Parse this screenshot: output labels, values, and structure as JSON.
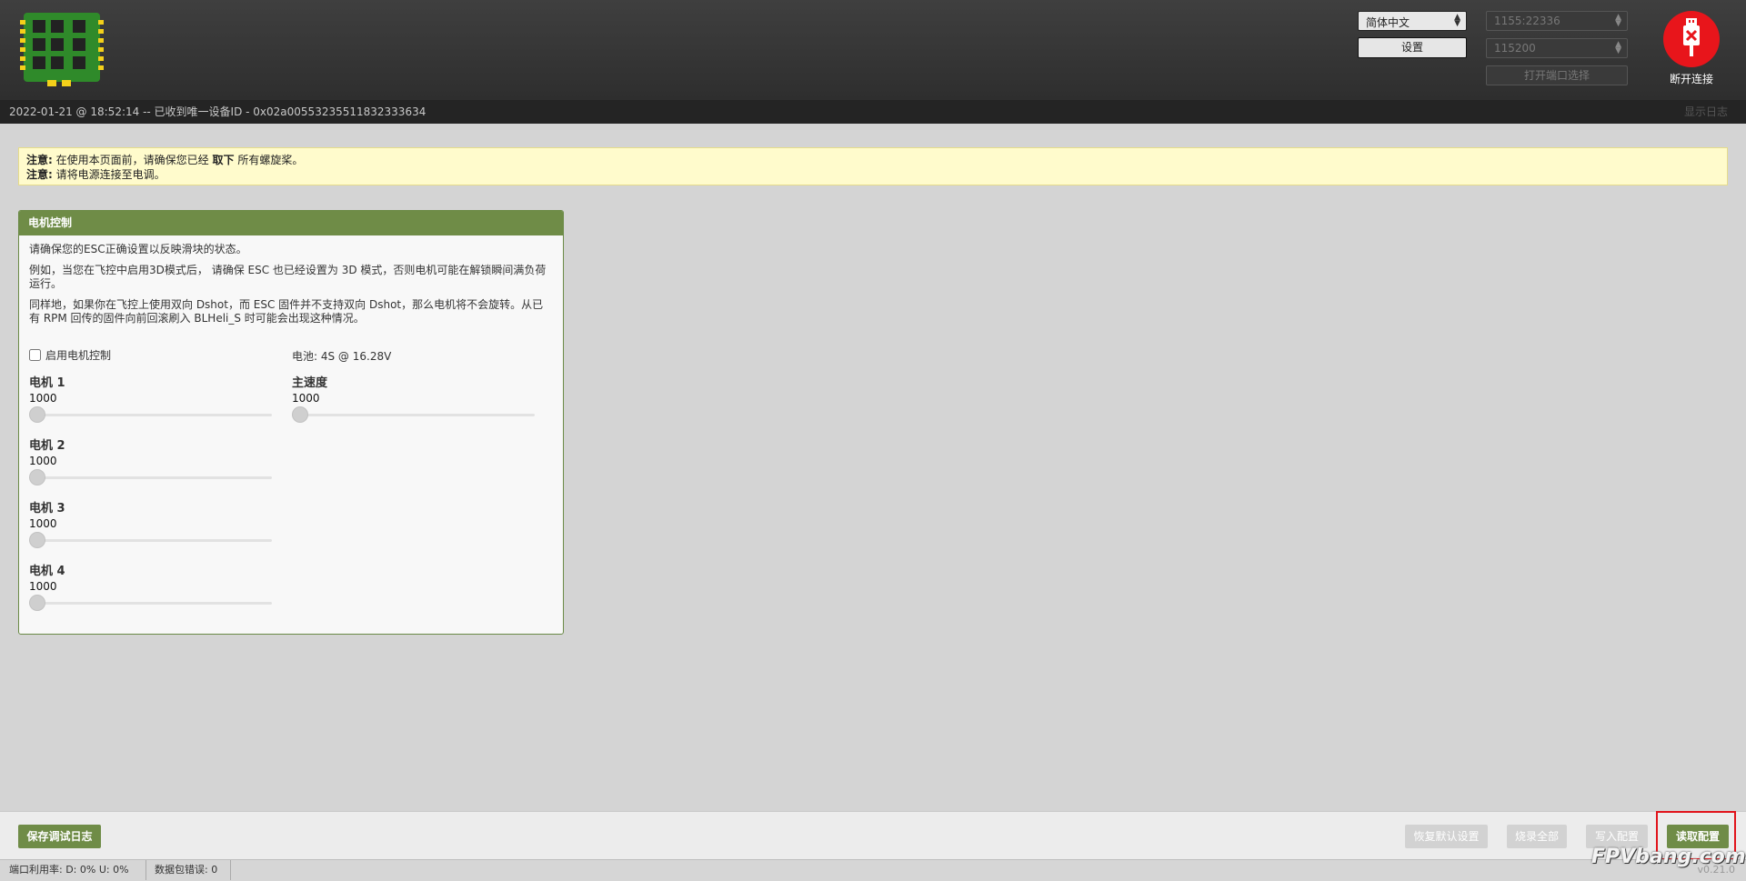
{
  "header": {
    "language": "简体中文",
    "settings_label": "设置",
    "port": "1155:22336",
    "baud": "115200",
    "open_port_label": "打开端口选择",
    "disconnect_label": "断开连接"
  },
  "statusbar": {
    "message": "2022-01-21 @ 18:52:14 -- 已收到唯一设备ID - 0x02a00553235511832333634",
    "show_log": "显示日志"
  },
  "notes": [
    {
      "label": "注意:",
      "text_before": "在使用本页面前，请确保您已经",
      "bold": "取下",
      "text_after": "所有螺旋桨。"
    },
    {
      "label": "注意:",
      "text_before": "请将电源连接至电调。",
      "bold": "",
      "text_after": ""
    }
  ],
  "motor_panel": {
    "title": "电机控制",
    "p1": "请确保您的ESC正确设置以反映滑块的状态。",
    "p2": "例如，当您在飞控中启用3D模式后， 请确保 ESC 也已经设置为 3D 模式，否则电机可能在解锁瞬间满负荷运行。",
    "p3": "同样地，如果你在飞控上使用双向 Dshot，而 ESC 固件并不支持双向 Dshot，那么电机将不会旋转。从已有 RPM 回传的固件向前回滚刷入 BLHeli_S 时可能会出现这种情况。",
    "enable_label": "启用电机控制",
    "battery": "电池: 4S @ 16.28V",
    "master": {
      "name": "主速度",
      "value": "1000",
      "fraction": 0
    },
    "motors": [
      {
        "name": "电机 1",
        "value": "1000",
        "fraction": 0
      },
      {
        "name": "电机 2",
        "value": "1000",
        "fraction": 0
      },
      {
        "name": "电机 3",
        "value": "1000",
        "fraction": 0
      },
      {
        "name": "电机 4",
        "value": "1000",
        "fraction": 0
      }
    ]
  },
  "toolbar": {
    "save_log": "保存调试日志",
    "restore_default": "恢复默认设置",
    "flash_all": "烧录全部",
    "write_config": "写入配置",
    "read_config": "读取配置"
  },
  "footer": {
    "port_usage": "端口利用率:   D: 0% U: 0%",
    "packet_errors": "数据包错误: 0",
    "version": "v0.21.0"
  },
  "watermark": "FPVbang.com"
}
